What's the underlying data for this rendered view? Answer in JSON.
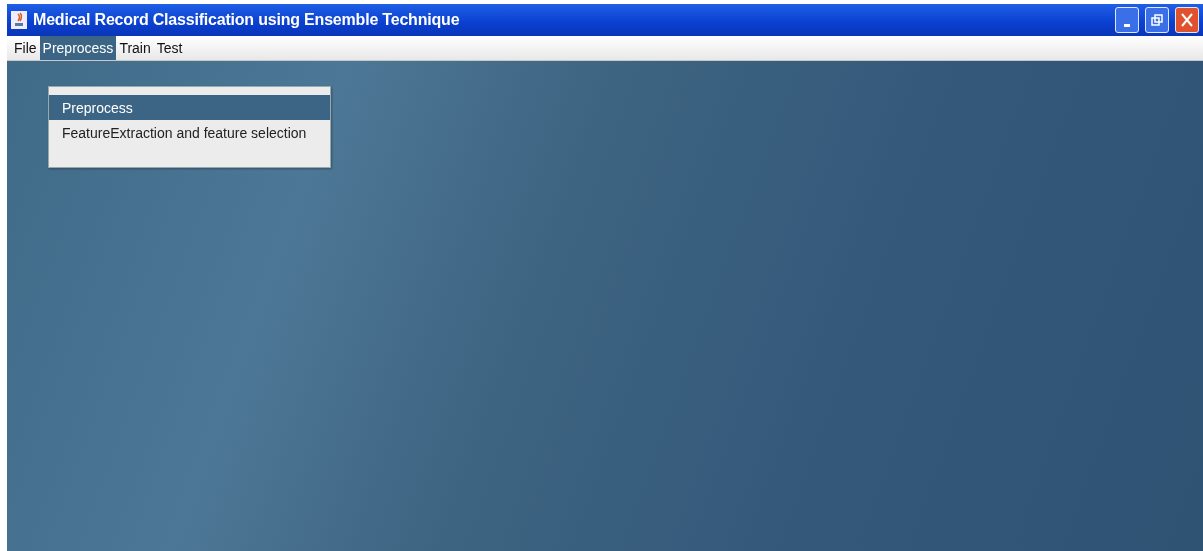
{
  "window": {
    "title": "Medical Record Classification using Ensemble Technique"
  },
  "menu_bar": [
    {
      "label": "File",
      "selected": false
    },
    {
      "label": "Preprocess",
      "selected": true
    },
    {
      "label": "Train",
      "selected": false
    },
    {
      "label": "Test",
      "selected": false
    }
  ],
  "open_menu": {
    "items": [
      {
        "label": "Preprocess",
        "selected": true
      },
      {
        "label": "FeatureExtraction and feature selection",
        "selected": false
      }
    ]
  }
}
